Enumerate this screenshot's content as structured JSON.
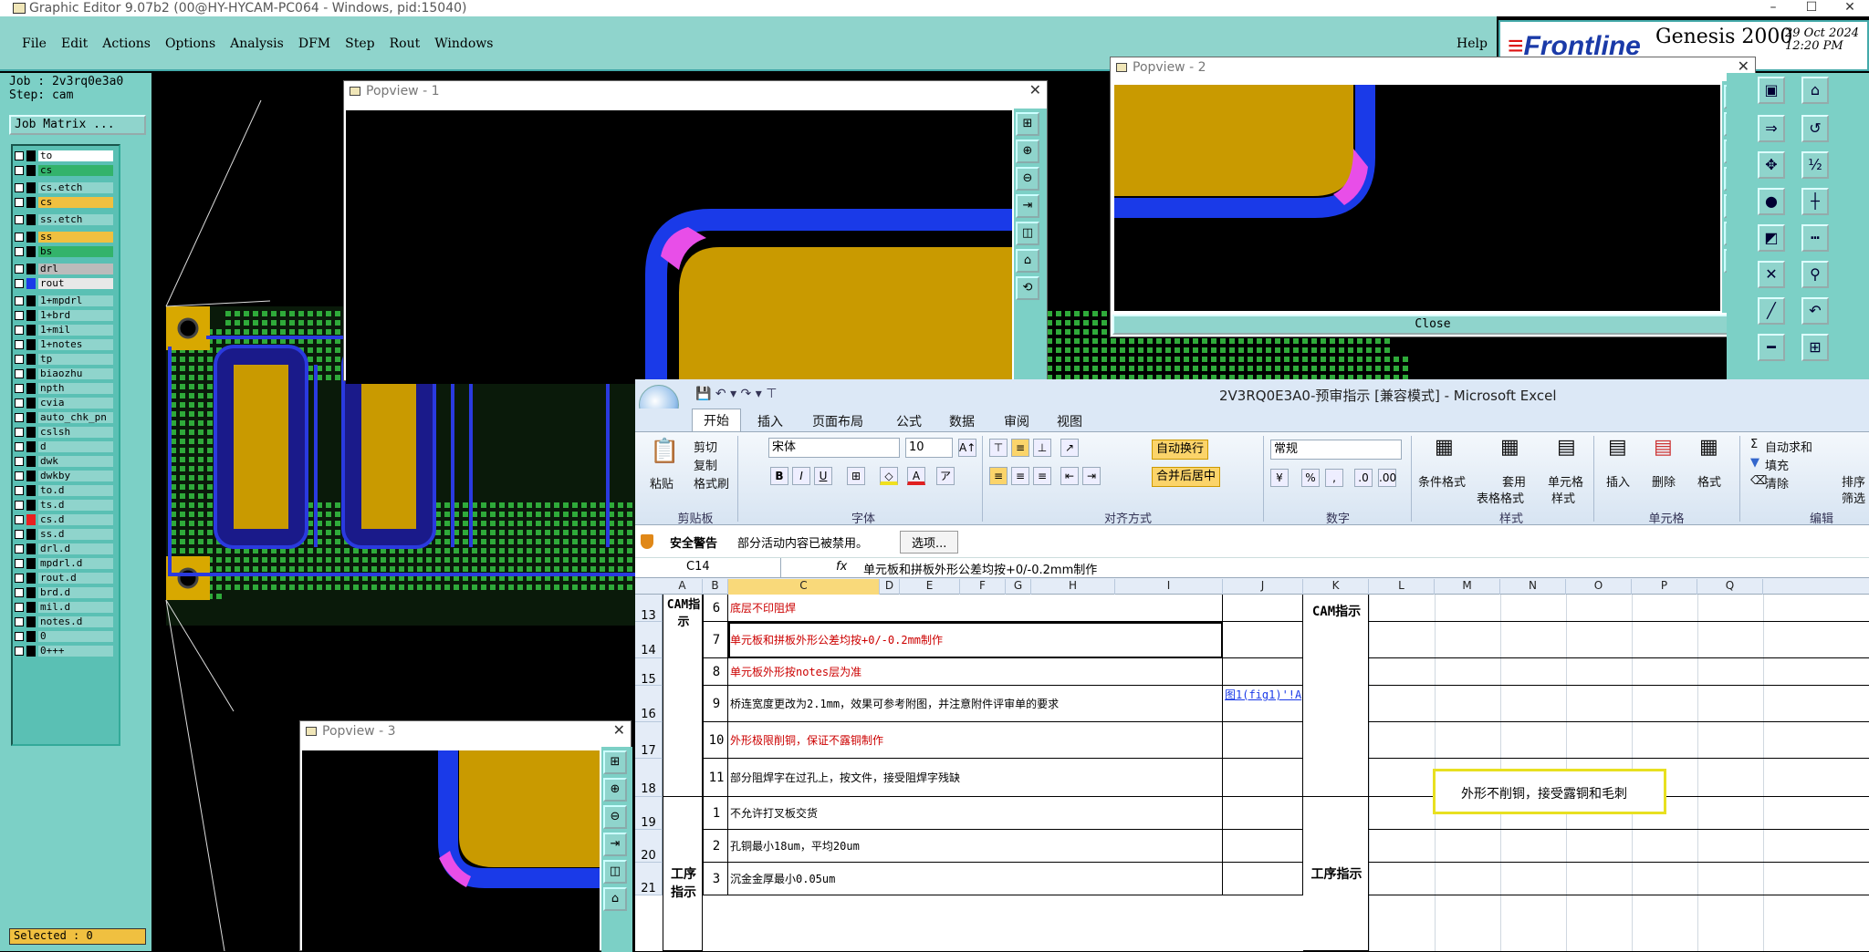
{
  "window": {
    "title": "Graphic Editor 9.07b2 (00@HY-HYCAM-PC064 - Windows, pid:15040)"
  },
  "menu": {
    "items": [
      "File",
      "Edit",
      "Actions",
      "Options",
      "Analysis",
      "DFM",
      "Step",
      "Rout",
      "Windows"
    ],
    "help": "Help"
  },
  "brand": {
    "logo_mark": "≡",
    "logo": "Frontline",
    "product": "Genesis 2000",
    "date": "29 Oct 2024",
    "time": "12:20 PM"
  },
  "job": {
    "job_line": "Job : 2v3rq0e3a0",
    "step_line": "Step: cam",
    "matrix_button": "Job Matrix ..."
  },
  "layers": [
    {
      "name": "to",
      "color": "#ffffff",
      "swatch": "#000000"
    },
    {
      "name": "cs",
      "color": "#33b36b",
      "swatch": "#000000"
    },
    {
      "name": "cs.etch",
      "color": "#8fd4cc",
      "swatch": "#000000"
    },
    {
      "name": "cs",
      "color": "#f0c040",
      "swatch": "#000000"
    },
    {
      "name": "ss.etch",
      "color": "#8fd4cc",
      "swatch": "#000000"
    },
    {
      "name": "ss",
      "color": "#f0c040",
      "swatch": "#000000"
    },
    {
      "name": "bs",
      "color": "#33b36b",
      "swatch": "#000000"
    },
    {
      "name": "drl",
      "color": "#bbbbbb",
      "swatch": "#000000"
    },
    {
      "name": "rout",
      "color": "#e8e8e8",
      "swatch": "#1a3ae8"
    },
    {
      "name": "1+mpdrl",
      "color": "#8fd4cc",
      "swatch": "#000000"
    },
    {
      "name": "1+brd",
      "color": "#8fd4cc",
      "swatch": "#000000"
    },
    {
      "name": "1+mil",
      "color": "#8fd4cc",
      "swatch": "#000000"
    },
    {
      "name": "1+notes",
      "color": "#8fd4cc",
      "swatch": "#000000"
    },
    {
      "name": "tp",
      "color": "#8fd4cc",
      "swatch": "#000000"
    },
    {
      "name": "biaozhu",
      "color": "#8fd4cc",
      "swatch": "#000000"
    },
    {
      "name": "npth",
      "color": "#8fd4cc",
      "swatch": "#000000"
    },
    {
      "name": "cvia",
      "color": "#8fd4cc",
      "swatch": "#000000"
    },
    {
      "name": "auto_chk_pn",
      "color": "#8fd4cc",
      "swatch": "#000000"
    },
    {
      "name": "cslsh",
      "color": "#8fd4cc",
      "swatch": "#000000"
    },
    {
      "name": "d",
      "color": "#8fd4cc",
      "swatch": "#000000"
    },
    {
      "name": "dwk",
      "color": "#8fd4cc",
      "swatch": "#000000"
    },
    {
      "name": "dwkby",
      "color": "#8fd4cc",
      "swatch": "#000000"
    },
    {
      "name": "to.d",
      "color": "#8fd4cc",
      "swatch": "#000000"
    },
    {
      "name": "ts.d",
      "color": "#8fd4cc",
      "swatch": "#000000"
    },
    {
      "name": "cs.d",
      "color": "#8fd4cc",
      "swatch": "#e82020"
    },
    {
      "name": "ss.d",
      "color": "#8fd4cc",
      "swatch": "#000000"
    },
    {
      "name": "drl.d",
      "color": "#8fd4cc",
      "swatch": "#000000"
    },
    {
      "name": "mpdrl.d",
      "color": "#8fd4cc",
      "swatch": "#000000"
    },
    {
      "name": "rout.d",
      "color": "#8fd4cc",
      "swatch": "#000000"
    },
    {
      "name": "brd.d",
      "color": "#8fd4cc",
      "swatch": "#000000"
    },
    {
      "name": "mil.d",
      "color": "#8fd4cc",
      "swatch": "#000000"
    },
    {
      "name": "notes.d",
      "color": "#8fd4cc",
      "swatch": "#000000"
    },
    {
      "name": "0",
      "color": "#8fd4cc",
      "swatch": "#000000"
    },
    {
      "name": "0+++",
      "color": "#8fd4cc",
      "swatch": "#000000"
    }
  ],
  "status": {
    "selected": "Selected : 0"
  },
  "popviews": [
    {
      "title": "Popview - 1"
    },
    {
      "title": "Popview - 2",
      "close_label": "Close"
    },
    {
      "title": "Popview - 3"
    }
  ],
  "excel": {
    "title": "2V3RQ0E3A0-预审指示 [兼容模式] - Microsoft Excel",
    "tabs": [
      "开始",
      "插入",
      "页面布局",
      "公式",
      "数据",
      "审阅",
      "视图"
    ],
    "ribbon": {
      "paste": "粘贴",
      "cut": "剪切",
      "copy": "复制",
      "format_painter": "格式刷",
      "clipboard": "剪贴板",
      "font_name": "宋体",
      "font_size": "10",
      "font_group": "字体",
      "wrap": "自动换行",
      "merge": "合并后居中",
      "align_group": "对齐方式",
      "number_format": "常规",
      "number_group": "数字",
      "cond_format": "条件格式",
      "table_format_1": "套用",
      "table_format_2": "表格格式",
      "cell_style_1": "单元格",
      "cell_style_2": "样式",
      "styles_group": "样式",
      "insert": "插入",
      "delete": "删除",
      "format": "格式",
      "cells_group": "单元格",
      "autosum": "自动求和",
      "fill": "填充",
      "clear": "清除",
      "sort_1": "排序",
      "sort_2": "筛选",
      "edit_group": "编辑"
    },
    "security": {
      "label": "安全警告",
      "message": "部分活动内容已被禁用。",
      "options": "选项..."
    },
    "formula": {
      "name_box": "C14",
      "fx": "fx",
      "value": "单元板和拼板外形公差均按+0/-0.2mm制作"
    },
    "columns": [
      "A",
      "B",
      "C",
      "D",
      "E",
      "F",
      "G",
      "H",
      "I",
      "J",
      "K",
      "L",
      "M",
      "N",
      "O",
      "P",
      "Q"
    ],
    "rows": [
      {
        "row": "13",
        "num": "6",
        "text": "底层不印阻焊",
        "red": true
      },
      {
        "row": "14",
        "num": "7",
        "text": "单元板和拼板外形公差均按+0/-0.2mm制作",
        "red": true
      },
      {
        "row": "15",
        "num": "8",
        "text": "单元板外形按notes层为准",
        "red": true
      },
      {
        "row": "16",
        "num": "9",
        "text": "桥连宽度更改为2.1mm，效果可参考附图，并注意附件评审单的要求",
        "red": false
      },
      {
        "row": "17",
        "num": "10",
        "text": "外形极限削铜，保证不露铜制作",
        "red": true
      },
      {
        "row": "18",
        "num": "11",
        "text": "部分阻焊字在过孔上，按文件，接受阻焊字残缺",
        "red": false
      },
      {
        "row": "19",
        "num": "1",
        "text": "不允许打叉板交货",
        "red": false
      },
      {
        "row": "20",
        "num": "2",
        "text": "孔铜最小18um，平均20um",
        "red": false
      },
      {
        "row": "21",
        "num": "3",
        "text": "沉金金厚最小0.05um",
        "red": false
      }
    ],
    "a_cam": "CAM指示",
    "a_process": "工序指示",
    "k_cam": "CAM指示",
    "k_process": "工序指示",
    "link": "图1(fig1)'!A",
    "callout": "外形不削铜，接受露铜和毛刺"
  }
}
